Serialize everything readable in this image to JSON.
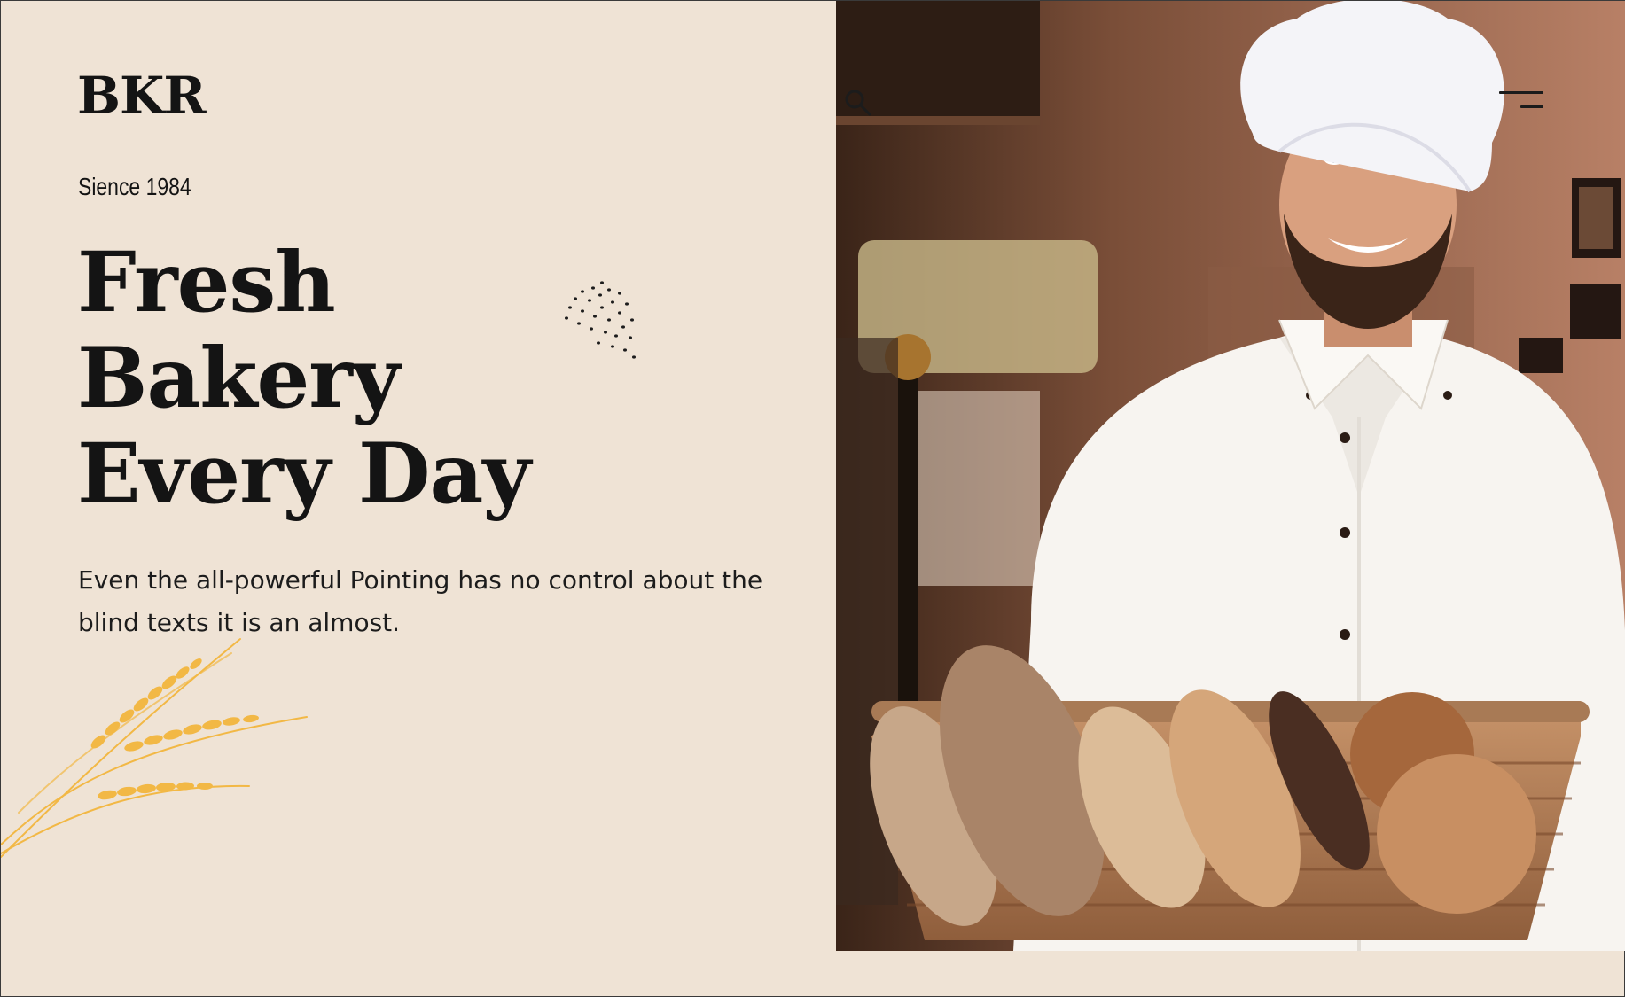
{
  "brand": {
    "logo_text": "BKR"
  },
  "hero": {
    "tagline": "Sience 1984",
    "headline_lines": [
      "Fresh",
      "Bakery",
      "Every Day"
    ],
    "description": "Even the all-powerful Pointing has no control about the blind texts it is an almost."
  },
  "header": {
    "search_icon": "search-icon",
    "menu_icon": "hamburger-menu-icon"
  },
  "colors": {
    "background": "#efe3d5",
    "text": "#141414",
    "accent_wheat": "#f2b845"
  }
}
